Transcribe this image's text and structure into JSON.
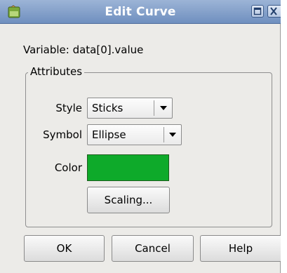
{
  "window": {
    "title": "Edit Curve",
    "titlebar_color": "#7f9bc8",
    "icons": [
      "app-icon",
      "maximize-icon",
      "close-icon"
    ]
  },
  "variable": {
    "label": "Variable:",
    "value": "data[0].value"
  },
  "attributes": {
    "legend": "Attributes",
    "style": {
      "label": "Style",
      "selected": "Sticks"
    },
    "symbol": {
      "label": "Symbol",
      "selected": "Ellipse"
    },
    "color": {
      "label": "Color",
      "value": "#0eaa2a"
    },
    "scaling_button": "Scaling..."
  },
  "buttons": {
    "ok": "OK",
    "cancel": "Cancel",
    "help": "Help"
  }
}
